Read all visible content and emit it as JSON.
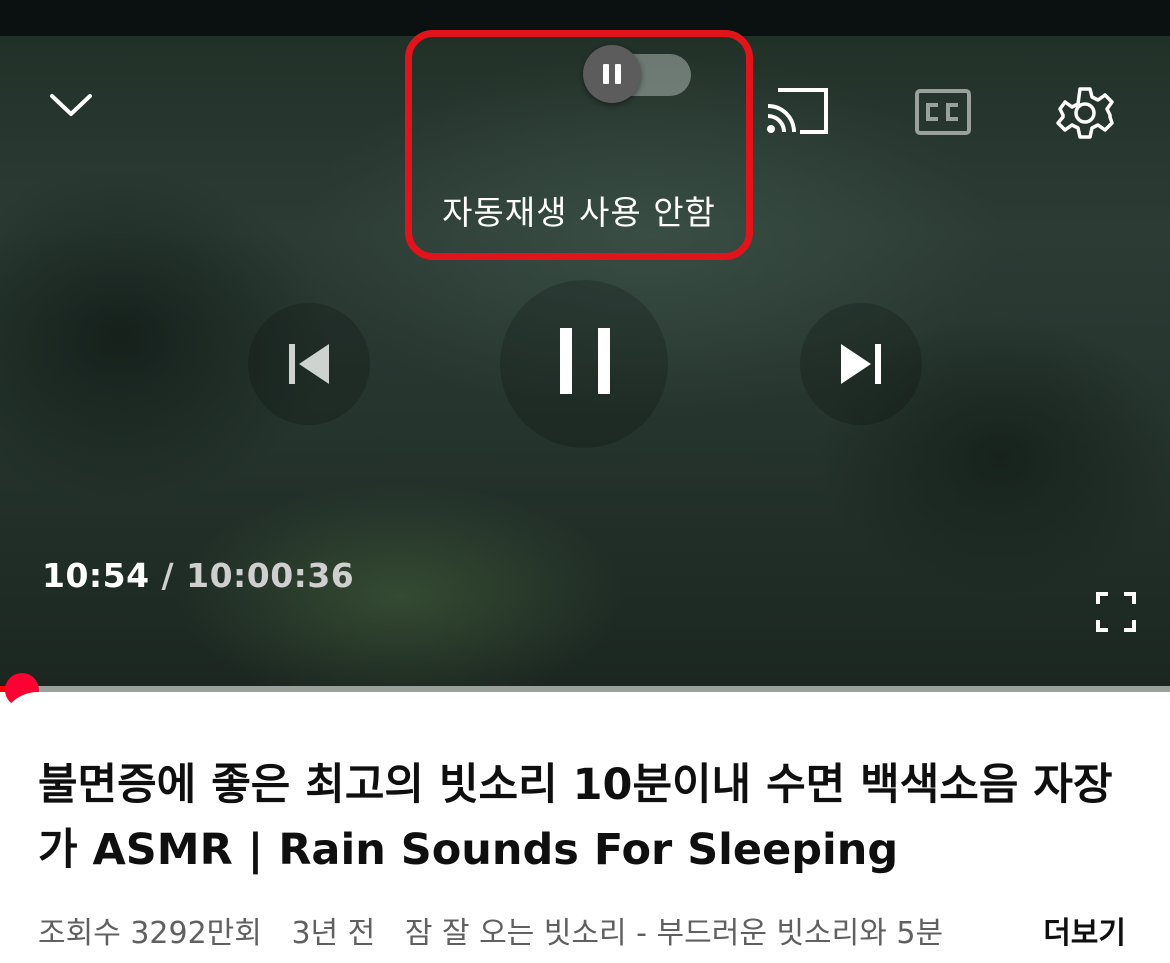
{
  "player": {
    "current_time": "10:54",
    "separator": "/",
    "duration": "10:00:36",
    "progress_fraction": 0.018,
    "autoplay": {
      "label": "자동재생 사용 안함",
      "enabled": false
    },
    "icons": {
      "collapse": "chevron-down-icon",
      "cast": "cast-icon",
      "captions": "cc-icon",
      "settings": "gear-icon",
      "previous": "skip-previous-icon",
      "play_pause": "pause-icon",
      "next": "skip-next-icon",
      "fullscreen": "fullscreen-icon"
    },
    "colors": {
      "highlight_border": "#e1141b",
      "progress": "#ff0000",
      "scrubber": "#ff0033"
    }
  },
  "video": {
    "title": "불면증에 좋은 최고의 빗소리 10분이내 수면 백색소음 자장가 ASMR | Rain Sounds For Sleeping",
    "views": "조회수 3292만회",
    "age": "3년 전",
    "description_snippet": "잠 잘 오는 빗소리 - 부드러운 빗소리와 5분",
    "more_label": "더보기"
  }
}
